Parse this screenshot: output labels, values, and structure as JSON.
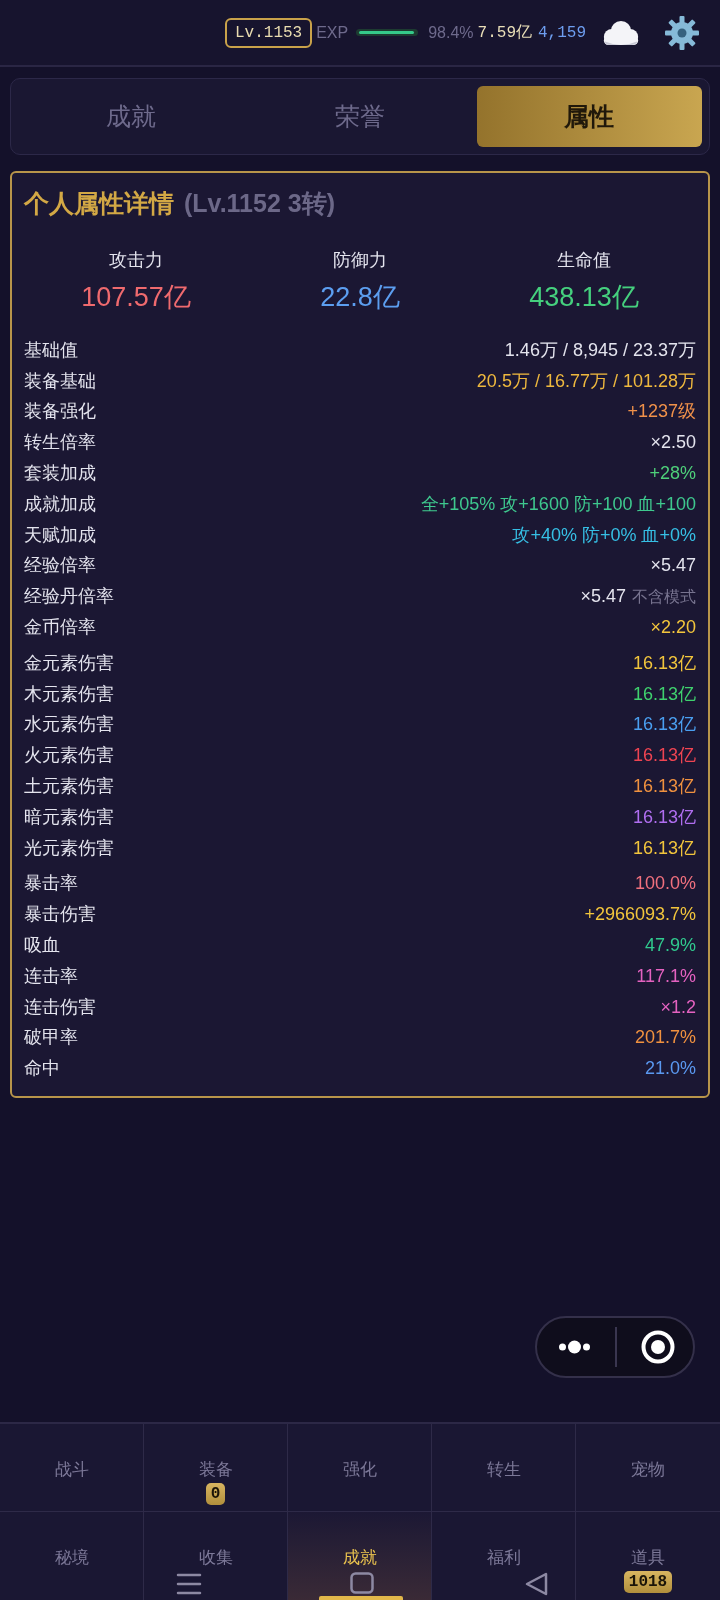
{
  "status_bar": {
    "level_badge": "Lv.1153",
    "exp_label": "EXP",
    "exp_bar": {
      "level": 0.984
    },
    "exp_percent": "98.4%",
    "gold": "7.59亿",
    "gems": "4,159"
  },
  "tabs": [
    {
      "label": "成就",
      "selected": false
    },
    {
      "label": "荣誉",
      "selected": false
    },
    {
      "label": "属性",
      "selected": true
    }
  ],
  "panel": {
    "title": "个人属性详情",
    "subtitle": "(Lv.1152 3转)",
    "stats": [
      {
        "label": "攻击力",
        "value": "107.57亿",
        "color": "#ef6a6e"
      },
      {
        "label": "防御力",
        "value": "22.8亿",
        "color": "#5c9ef0"
      },
      {
        "label": "生命值",
        "value": "438.13亿",
        "color": "#45d07e"
      }
    ],
    "groups": [
      {
        "rows": [
          {
            "label": "基础值",
            "value": "1.46万 / 8,945 / 23.37万",
            "color": "#e4e4ee"
          },
          {
            "label": "装备基础",
            "value": "20.5万 / 16.77万 / 101.28万",
            "color": "#eeb83e"
          },
          {
            "label": "装备强化",
            "value": "+1237级",
            "color": "#f0914a"
          },
          {
            "label": "转生倍率",
            "value": "×2.50",
            "color": "#e4e4ee"
          },
          {
            "label": "套装加成",
            "value": "+28%",
            "color": "#4ed07a"
          },
          {
            "label": "成就加成",
            "value": "全+105% 攻+1600 防+100 血+100",
            "color": "#3ec88e"
          },
          {
            "label": "天赋加成",
            "value": "攻+40% 防+0% 血+0%",
            "color": "#36bfe4"
          },
          {
            "label": "经验倍率",
            "value": "×5.47",
            "color": "#e4e4ee"
          },
          {
            "label": "经验丹倍率",
            "value": "×5.47",
            "note": "不含模式",
            "color": "#e4e4ee"
          },
          {
            "label": "金币倍率",
            "value": "×2.20",
            "color": "#f2c53c"
          }
        ]
      },
      {
        "rows": [
          {
            "label": "金元素伤害",
            "value": "16.13亿",
            "color": "#f2c53c"
          },
          {
            "label": "木元素伤害",
            "value": "16.13亿",
            "color": "#3fd16e"
          },
          {
            "label": "水元素伤害",
            "value": "16.13亿",
            "color": "#4a9ff0"
          },
          {
            "label": "火元素伤害",
            "value": "16.13亿",
            "color": "#ef4452"
          },
          {
            "label": "土元素伤害",
            "value": "16.13亿",
            "color": "#f0913f"
          },
          {
            "label": "暗元素伤害",
            "value": "16.13亿",
            "color": "#b06ef0"
          },
          {
            "label": "光元素伤害",
            "value": "16.13亿",
            "color": "#f2c53c"
          }
        ]
      },
      {
        "rows": [
          {
            "label": "暴击率",
            "value": "100.0%",
            "color": "#f0707e"
          },
          {
            "label": "暴击伤害",
            "value": "+2966093.7%",
            "color": "#f2c53c"
          },
          {
            "label": "吸血",
            "value": "47.9%",
            "color": "#30c98e"
          },
          {
            "label": "连击率",
            "value": "117.1%",
            "color": "#e462c0"
          },
          {
            "label": "连击伤害",
            "value": "×1.2",
            "color": "#e462c0"
          },
          {
            "label": "破甲率",
            "value": "201.7%",
            "color": "#f0913f"
          },
          {
            "label": "命中",
            "value": "21.0%",
            "color": "#5a98f0"
          }
        ]
      }
    ]
  },
  "bottom_nav": [
    {
      "label": "战斗",
      "selected": false
    },
    {
      "label": "装备",
      "selected": false,
      "badge": "0"
    },
    {
      "label": "强化",
      "selected": false
    },
    {
      "label": "转生",
      "selected": false
    },
    {
      "label": "宠物",
      "selected": false
    },
    {
      "label": "秘境",
      "selected": false
    },
    {
      "label": "收集",
      "selected": false
    },
    {
      "label": "成就",
      "selected": true
    },
    {
      "label": "福利",
      "selected": false
    },
    {
      "label": "道具",
      "selected": false,
      "badge": "1018"
    }
  ]
}
